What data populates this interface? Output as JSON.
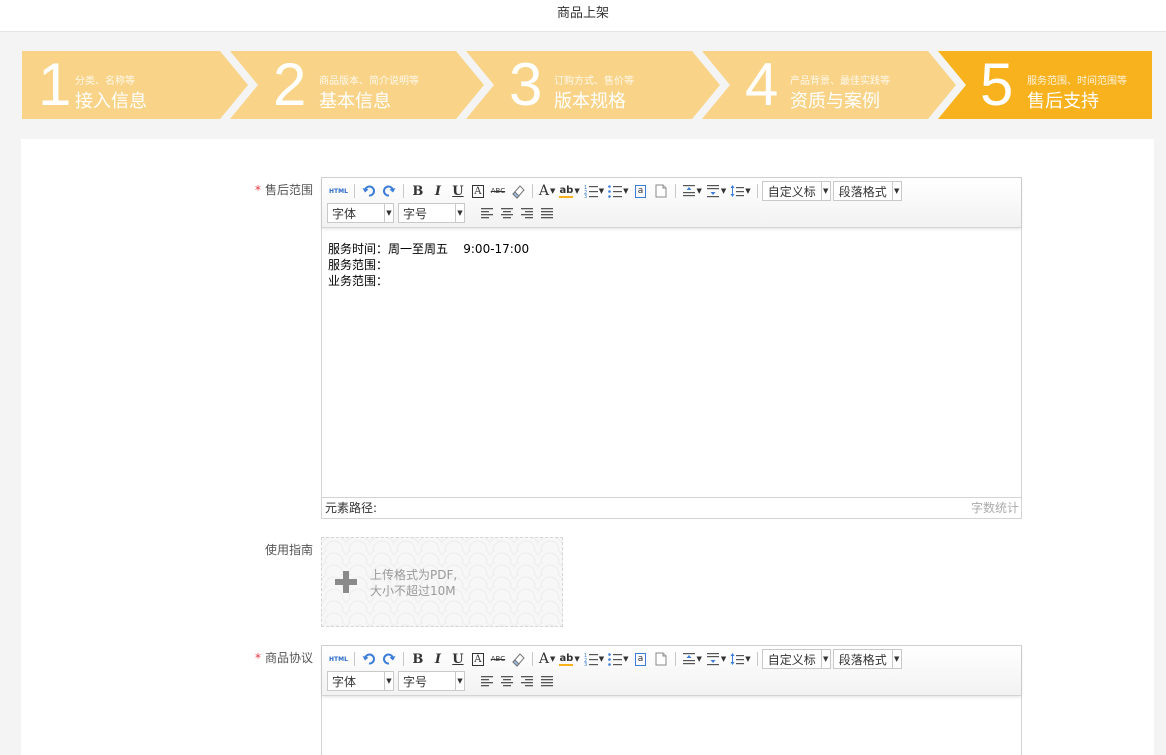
{
  "header": {
    "title": "商品上架"
  },
  "steps": [
    {
      "num": "1",
      "sub": "分类、名称等",
      "title": "接入信息",
      "state": "done"
    },
    {
      "num": "2",
      "sub": "商品版本、简介说明等",
      "title": "基本信息",
      "state": "done"
    },
    {
      "num": "3",
      "sub": "订购方式、售价等",
      "title": "版本规格",
      "state": "done"
    },
    {
      "num": "4",
      "sub": "产品背景、最佳实践等",
      "title": "资质与案例",
      "state": "done"
    },
    {
      "num": "5",
      "sub": "服务范围、时间范围等",
      "title": "售后支持",
      "state": "active"
    }
  ],
  "colors": {
    "step_done": "#f9d488",
    "step_active": "#f7b21e",
    "required_star": "#e4393c"
  },
  "editor_toolbar": {
    "buttons": [
      "HTML",
      "undo-icon",
      "redo-icon",
      "B",
      "I",
      "U",
      "A",
      "ABC",
      "eraser-icon",
      "A",
      "ab",
      "ordered-list-icon",
      "unordered-list-icon",
      "a",
      "page-icon",
      "row-spacing-top-icon",
      "row-spacing-bottom-icon",
      "line-height-icon"
    ],
    "custom_title": "自定义标",
    "paragraph_format": "段落格式",
    "font": "字体",
    "font_size": "字号"
  },
  "after_sales": {
    "label": "售后范围",
    "required": true,
    "lines": [
      "服务时间：周一至周五    9:00-17:00",
      "服务范围：",
      "业务范围："
    ],
    "path_label": "元素路径:",
    "word_count_label": "字数统计"
  },
  "guide": {
    "label": "使用指南",
    "hint_line1": "上传格式为PDF,",
    "hint_line2": "大小不超过10M"
  },
  "agreement": {
    "label": "商品协议",
    "required": true,
    "lines": []
  }
}
